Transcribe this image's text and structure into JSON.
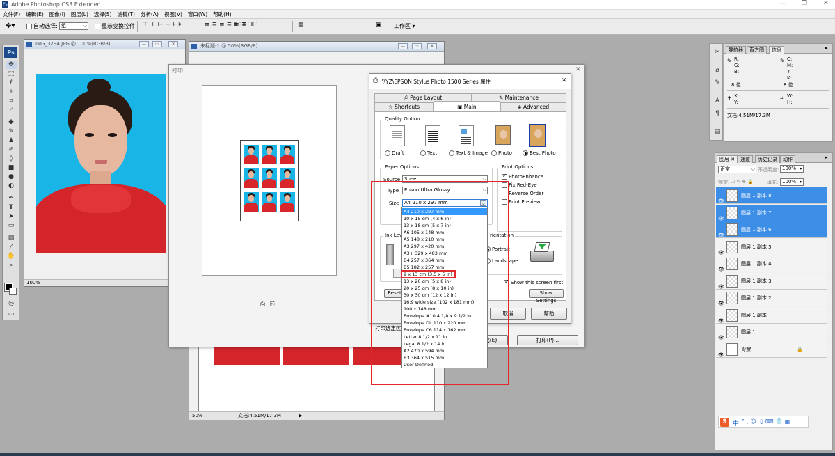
{
  "app": {
    "title": "Adobe Photoshop CS3 Extended"
  },
  "menus": [
    "文件(F)",
    "编辑(E)",
    "图像(I)",
    "图层(L)",
    "选择(S)",
    "滤镜(T)",
    "分析(A)",
    "视图(V)",
    "窗口(W)",
    "帮助(H)"
  ],
  "options": {
    "auto_select": "自动选择:",
    "auto_select_value": "组",
    "show_transform": "显示变换控件",
    "workspace": "工作区"
  },
  "doc1": {
    "title": "IMG_3794.JPG @ 100%(RGB/8)",
    "zoom": "100%"
  },
  "doc2": {
    "title": "未标题-1 @ 50%(RGB/8)",
    "zoom": "50%",
    "status": "文档:4.51M/17.3M"
  },
  "print_dialog": {
    "title": "打印",
    "print_selected": "打印选定区",
    "done_label": "完成(E)",
    "print_label": "打印(P)..."
  },
  "epson": {
    "title": "\\\\YZ\\EPSON Stylus Photo 1500 Series 属性",
    "tabs": [
      "Page Layout",
      "Maintenance",
      "Shortcuts",
      "Main",
      "Advanced"
    ],
    "quality_label": "Quality Option",
    "quality_options": [
      "Draft",
      "Text",
      "Text & Image",
      "Photo",
      "Best Photo"
    ],
    "quality_selected": "Best Photo",
    "paper_label": "Paper Options",
    "source_label": "Source",
    "source_value": "Sheet",
    "type_label": "Type",
    "type_value": "Epson Ultra Glossy",
    "size_label": "Size",
    "size_value": "A4 210 x 297 mm",
    "size_options": [
      "A4 210 x 297 mm",
      "10 x 15 cm (4 x 6 in)",
      "13 x 18 cm (5 x 7 in)",
      "A6 105 x 148 mm",
      "A5 148 x 210 mm",
      "A3 297 x 420 mm",
      "A3+ 329 x 483 mm",
      "B4 257 x 364 mm",
      "B5 182 x 257 mm",
      "9 x 13 cm (3.5 x 5 in)",
      "13 x 20 cm (5 x 8 in)",
      "20 x 25 cm (8 x 10 in)",
      "30 x 30 cm (12 x 12 in)",
      "16:9 wide size (102 x 181 mm)",
      "100 x 148 mm",
      "Envelope #10 4 1/8 x 9 1/2 in",
      "Envelope DL  110 x 220 mm",
      "Envelope C6  114 x 162 mm",
      "Letter 8 1/2 x 11 in",
      "Legal 8 1/2 x 14 in",
      "A2 420 x 594 mm",
      "B3 364 x 515 mm",
      "User Defined"
    ],
    "highlighted_option": "9 x 13 cm (3.5 x 5 in)",
    "print_options_label": "Print Options",
    "print_options": [
      {
        "label": "PhotoEnhance",
        "checked": true
      },
      {
        "label": "Fix Red-Eye",
        "checked": false
      },
      {
        "label": "Reverse Order",
        "checked": false
      },
      {
        "label": "Print Preview",
        "checked": false
      }
    ],
    "ink_label": "Ink Lev",
    "orientation_label": "rientation",
    "portrait": "Portrait",
    "landscape": "Landscape",
    "show_screen_first": "Show this screen first",
    "show_settings": "Show Settings",
    "reset": "Reset",
    "cancel": "取消",
    "help": "帮助"
  },
  "info_panel": {
    "tabs": [
      "导航器",
      "直方图",
      "信息"
    ],
    "r": "R:",
    "g": "G:",
    "b": "B:",
    "c": "C:",
    "m": "M:",
    "y": "Y:",
    "k": "K:",
    "bits1": "8 位",
    "bits2": "8 位",
    "x": "X:",
    "y2": "Y:",
    "w": "W:",
    "h": "H:",
    "doc": "文档:4.51M/17.3M"
  },
  "layers_panel": {
    "tabs": [
      "图层",
      "通道",
      "历史记录",
      "动作"
    ],
    "blend": "正常",
    "opacity_label": "不透明度:",
    "opacity": "100%",
    "lock_label": "锁定:",
    "fill_label": "填充:",
    "fill": "100%",
    "layers": [
      {
        "name": "图层 1 副本 8",
        "selected": true
      },
      {
        "name": "图层 1 副本 7",
        "selected": true
      },
      {
        "name": "图层 1 副本 6",
        "selected": true
      },
      {
        "name": "图层 1 副本 5",
        "selected": false
      },
      {
        "name": "图层 1 副本 4",
        "selected": false
      },
      {
        "name": "图层 1 副本 3",
        "selected": false
      },
      {
        "name": "图层 1 副本 2",
        "selected": false
      },
      {
        "name": "图层 1 副本",
        "selected": false
      },
      {
        "name": "图层 1",
        "selected": false
      },
      {
        "name": "背景",
        "selected": false
      }
    ]
  },
  "ime": {
    "label": "中"
  },
  "colors": {
    "highlight": "#3399ff",
    "annotation": "#e0282d",
    "layer_selected": "#3d8ee6",
    "photo_bg": "#19b5e6"
  }
}
